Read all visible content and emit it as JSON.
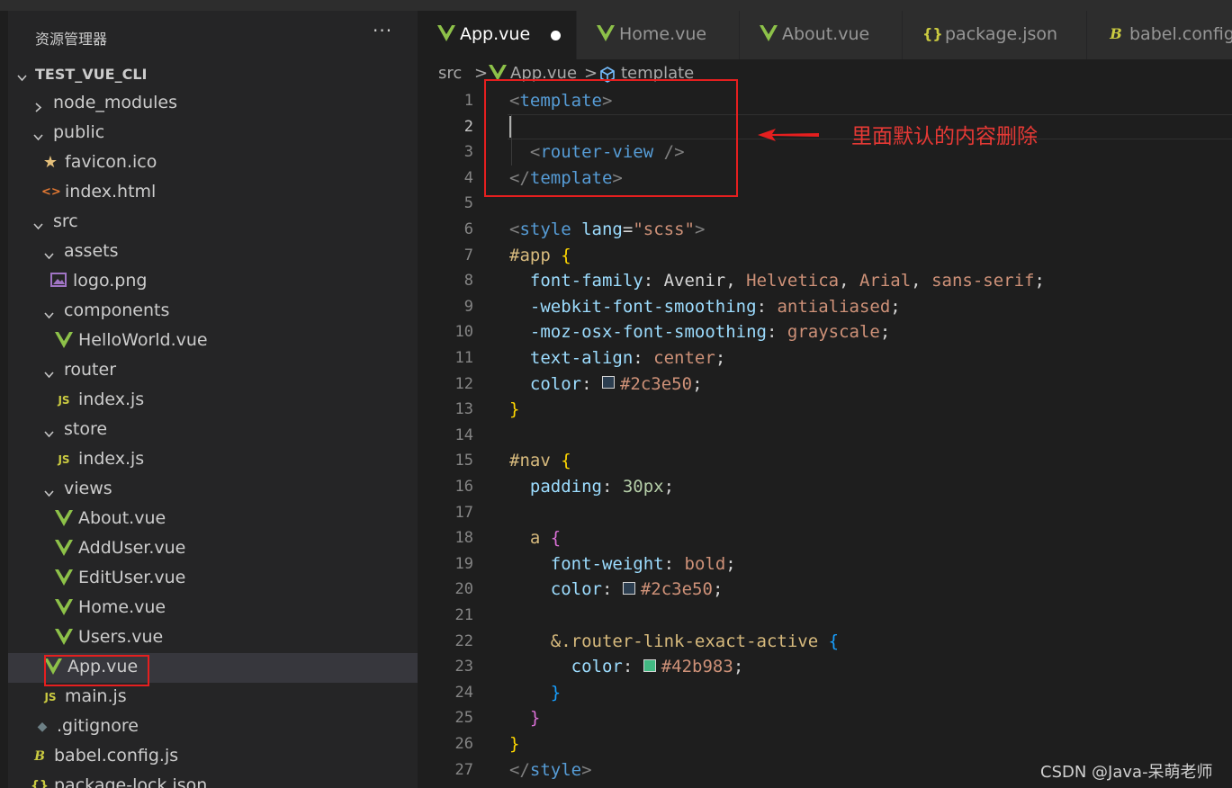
{
  "explorer": {
    "title": "资源管理器",
    "more": "···",
    "root": "TEST_VUE_CLI",
    "items": [
      {
        "label": "node_modules",
        "type": "folder",
        "expanded": false,
        "icon": "chevron-right-icon"
      },
      {
        "label": "public",
        "type": "folder",
        "expanded": true,
        "icon": "chevron-down-icon"
      },
      {
        "label": "favicon.ico",
        "type": "file",
        "icon": "star-icon"
      },
      {
        "label": "index.html",
        "type": "file",
        "icon": "html-icon"
      },
      {
        "label": "src",
        "type": "folder",
        "expanded": true,
        "icon": "chevron-down-icon"
      },
      {
        "label": "assets",
        "type": "folder",
        "expanded": true,
        "icon": "chevron-down-icon"
      },
      {
        "label": "logo.png",
        "type": "file",
        "icon": "image-icon"
      },
      {
        "label": "components",
        "type": "folder",
        "expanded": true,
        "icon": "chevron-down-icon"
      },
      {
        "label": "HelloWorld.vue",
        "type": "file",
        "icon": "vue-icon"
      },
      {
        "label": "router",
        "type": "folder",
        "expanded": true,
        "icon": "chevron-down-icon"
      },
      {
        "label": "index.js",
        "type": "file",
        "icon": "js-icon"
      },
      {
        "label": "store",
        "type": "folder",
        "expanded": true,
        "icon": "chevron-down-icon"
      },
      {
        "label": "index.js",
        "type": "file",
        "icon": "js-icon"
      },
      {
        "label": "views",
        "type": "folder",
        "expanded": true,
        "icon": "chevron-down-icon"
      },
      {
        "label": "About.vue",
        "type": "file",
        "icon": "vue-icon"
      },
      {
        "label": "AddUser.vue",
        "type": "file",
        "icon": "vue-icon"
      },
      {
        "label": "EditUser.vue",
        "type": "file",
        "icon": "vue-icon"
      },
      {
        "label": "Home.vue",
        "type": "file",
        "icon": "vue-icon"
      },
      {
        "label": "Users.vue",
        "type": "file",
        "icon": "vue-icon"
      },
      {
        "label": "App.vue",
        "type": "file",
        "icon": "vue-icon",
        "selected": true
      },
      {
        "label": "main.js",
        "type": "file",
        "icon": "js-icon"
      },
      {
        "label": ".gitignore",
        "type": "file",
        "icon": "git-icon"
      },
      {
        "label": "babel.config.js",
        "type": "file",
        "icon": "babel-icon"
      },
      {
        "label": "package-lock.json",
        "type": "file",
        "icon": "json-icon"
      }
    ]
  },
  "tabs": [
    {
      "label": "App.vue",
      "icon": "vue-icon",
      "active": true,
      "modified": true
    },
    {
      "label": "Home.vue",
      "icon": "vue-icon",
      "active": false
    },
    {
      "label": "About.vue",
      "icon": "vue-icon",
      "active": false
    },
    {
      "label": "package.json",
      "icon": "json-icon",
      "active": false
    },
    {
      "label": "babel.config.js",
      "icon": "babel-icon",
      "active": false
    }
  ],
  "breadcrumb": {
    "src": "src",
    "file": "App.vue",
    "symbol": "template",
    "sep": ">"
  },
  "editor": {
    "current_line": 2,
    "lines": [
      [
        [
          "k-punc",
          "<"
        ],
        [
          "k-tag",
          "template"
        ],
        [
          "k-punc",
          ">"
        ]
      ],
      [],
      [
        [
          "k-txt",
          "  "
        ],
        [
          "k-punc",
          "<"
        ],
        [
          "k-tag",
          "router-view"
        ],
        [
          "k-txt",
          " "
        ],
        [
          "k-punc",
          "/>"
        ]
      ],
      [
        [
          "k-punc",
          "</"
        ],
        [
          "k-tag",
          "template"
        ],
        [
          "k-punc",
          ">"
        ]
      ],
      [],
      [
        [
          "k-punc",
          "<"
        ],
        [
          "k-tag",
          "style"
        ],
        [
          "k-txt",
          " "
        ],
        [
          "k-attr",
          "lang"
        ],
        [
          "k-txt",
          "="
        ],
        [
          "k-str",
          "\"scss\""
        ],
        [
          "k-punc",
          ">"
        ]
      ],
      [
        [
          "k-sel",
          "#app"
        ],
        [
          "k-txt",
          " "
        ],
        [
          "k-b1",
          "{"
        ]
      ],
      [
        [
          "k-txt",
          "  "
        ],
        [
          "k-attr",
          "font-family"
        ],
        [
          "k-txt",
          ": Avenir, "
        ],
        [
          "k-str",
          "Helvetica"
        ],
        [
          "k-txt",
          ", "
        ],
        [
          "k-str",
          "Arial"
        ],
        [
          "k-txt",
          ", "
        ],
        [
          "k-str",
          "sans-serif"
        ],
        [
          "k-txt",
          ";"
        ]
      ],
      [
        [
          "k-txt",
          "  "
        ],
        [
          "k-attr",
          "-webkit-font-smoothing"
        ],
        [
          "k-txt",
          ": "
        ],
        [
          "k-str",
          "antialiased"
        ],
        [
          "k-txt",
          ";"
        ]
      ],
      [
        [
          "k-txt",
          "  "
        ],
        [
          "k-attr",
          "-moz-osx-font-smoothing"
        ],
        [
          "k-txt",
          ": "
        ],
        [
          "k-str",
          "grayscale"
        ],
        [
          "k-txt",
          ";"
        ]
      ],
      [
        [
          "k-txt",
          "  "
        ],
        [
          "k-attr",
          "text-align"
        ],
        [
          "k-txt",
          ": "
        ],
        [
          "k-str",
          "center"
        ],
        [
          "k-txt",
          ";"
        ]
      ],
      [
        [
          "k-txt",
          "  "
        ],
        [
          "k-attr",
          "color"
        ],
        [
          "k-txt",
          ": "
        ],
        [
          "swatch",
          "#2c3e50"
        ],
        [
          "k-str",
          "#2c3e50"
        ],
        [
          "k-txt",
          ";"
        ]
      ],
      [
        [
          "k-b1",
          "}"
        ]
      ],
      [],
      [
        [
          "k-sel",
          "#nav"
        ],
        [
          "k-txt",
          " "
        ],
        [
          "k-b1",
          "{"
        ]
      ],
      [
        [
          "k-txt",
          "  "
        ],
        [
          "k-attr",
          "padding"
        ],
        [
          "k-txt",
          ": "
        ],
        [
          "k-num",
          "30px"
        ],
        [
          "k-txt",
          ";"
        ]
      ],
      [],
      [
        [
          "k-txt",
          "  "
        ],
        [
          "k-sel",
          "a"
        ],
        [
          "k-txt",
          " "
        ],
        [
          "k-b2",
          "{"
        ]
      ],
      [
        [
          "k-txt",
          "    "
        ],
        [
          "k-attr",
          "font-weight"
        ],
        [
          "k-txt",
          ": "
        ],
        [
          "k-str",
          "bold"
        ],
        [
          "k-txt",
          ";"
        ]
      ],
      [
        [
          "k-txt",
          "    "
        ],
        [
          "k-attr",
          "color"
        ],
        [
          "k-txt",
          ": "
        ],
        [
          "swatch",
          "#2c3e50"
        ],
        [
          "k-str",
          "#2c3e50"
        ],
        [
          "k-txt",
          ";"
        ]
      ],
      [],
      [
        [
          "k-txt",
          "    "
        ],
        [
          "k-sel",
          "&.router-link-exact-active"
        ],
        [
          "k-txt",
          " "
        ],
        [
          "k-b3",
          "{"
        ]
      ],
      [
        [
          "k-txt",
          "      "
        ],
        [
          "k-attr",
          "color"
        ],
        [
          "k-txt",
          ": "
        ],
        [
          "swatch",
          "#42b983"
        ],
        [
          "k-str",
          "#42b983"
        ],
        [
          "k-txt",
          ";"
        ]
      ],
      [
        [
          "k-txt",
          "    "
        ],
        [
          "k-b3",
          "}"
        ]
      ],
      [
        [
          "k-txt",
          "  "
        ],
        [
          "k-b2",
          "}"
        ]
      ],
      [
        [
          "k-b1",
          "}"
        ]
      ],
      [
        [
          "k-punc",
          "</"
        ],
        [
          "k-tag",
          "style"
        ],
        [
          "k-punc",
          ">"
        ]
      ]
    ]
  },
  "annotation": {
    "text": "里面默认的内容删除"
  },
  "watermark": "CSDN @Java-呆萌老师",
  "colors": {
    "vue": "#8dc149",
    "js": "#cbcb41",
    "html": "#e37933",
    "json": "#cbcb41",
    "star": "#e5c07b",
    "image": "#a074c4",
    "git": "#6d8086",
    "annotation": "#e51f1f"
  }
}
